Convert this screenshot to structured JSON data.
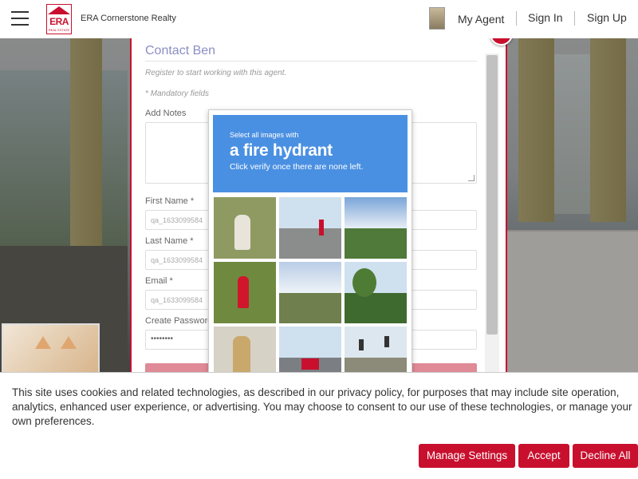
{
  "header": {
    "menu_icon": "hamburger-icon",
    "logo_text": "ERA",
    "logo_subtext": "REAL ESTATE",
    "brand": "ERA Cornerstone Realty",
    "nav": [
      "My Agent",
      "Sign In",
      "Sign Up"
    ]
  },
  "modal": {
    "title": "Contact Ben",
    "subtitle": "Register to start working with this agent.",
    "mandatory": "* Mandatory fields",
    "notes_label": "Add Notes",
    "fields": [
      {
        "label": "First Name *",
        "value": "qa_1633099584"
      },
      {
        "label": "Last Name *",
        "value": "qa_1633099584"
      },
      {
        "label": "Email *",
        "value": "qa_1633099584"
      },
      {
        "label": "Create Password",
        "value": "••••••••"
      }
    ],
    "close_icon": "close-icon",
    "accent": "#c8102e"
  },
  "captcha": {
    "line1": "Select all images with",
    "line2": "a fire hydrant",
    "line3": "Click verify once there are none left.",
    "header_color": "#4a90e2",
    "tiles": [
      "fire hydrant",
      "road intersection",
      "street with trees",
      "red fire hydrant",
      "highway with power lines",
      "palm trees street",
      "fire hydrant close-up",
      "traffic on road",
      "traffic lights"
    ]
  },
  "cookie": {
    "text": "This site uses cookies and related technologies, as described in our privacy policy, for purposes that may include site operation, analytics, enhanced user experience, or advertising. You may choose to consent to our use of these technologies, or manage your own preferences.",
    "buttons": [
      "Manage Settings",
      "Accept",
      "Decline All"
    ],
    "button_color": "#c8102e"
  }
}
